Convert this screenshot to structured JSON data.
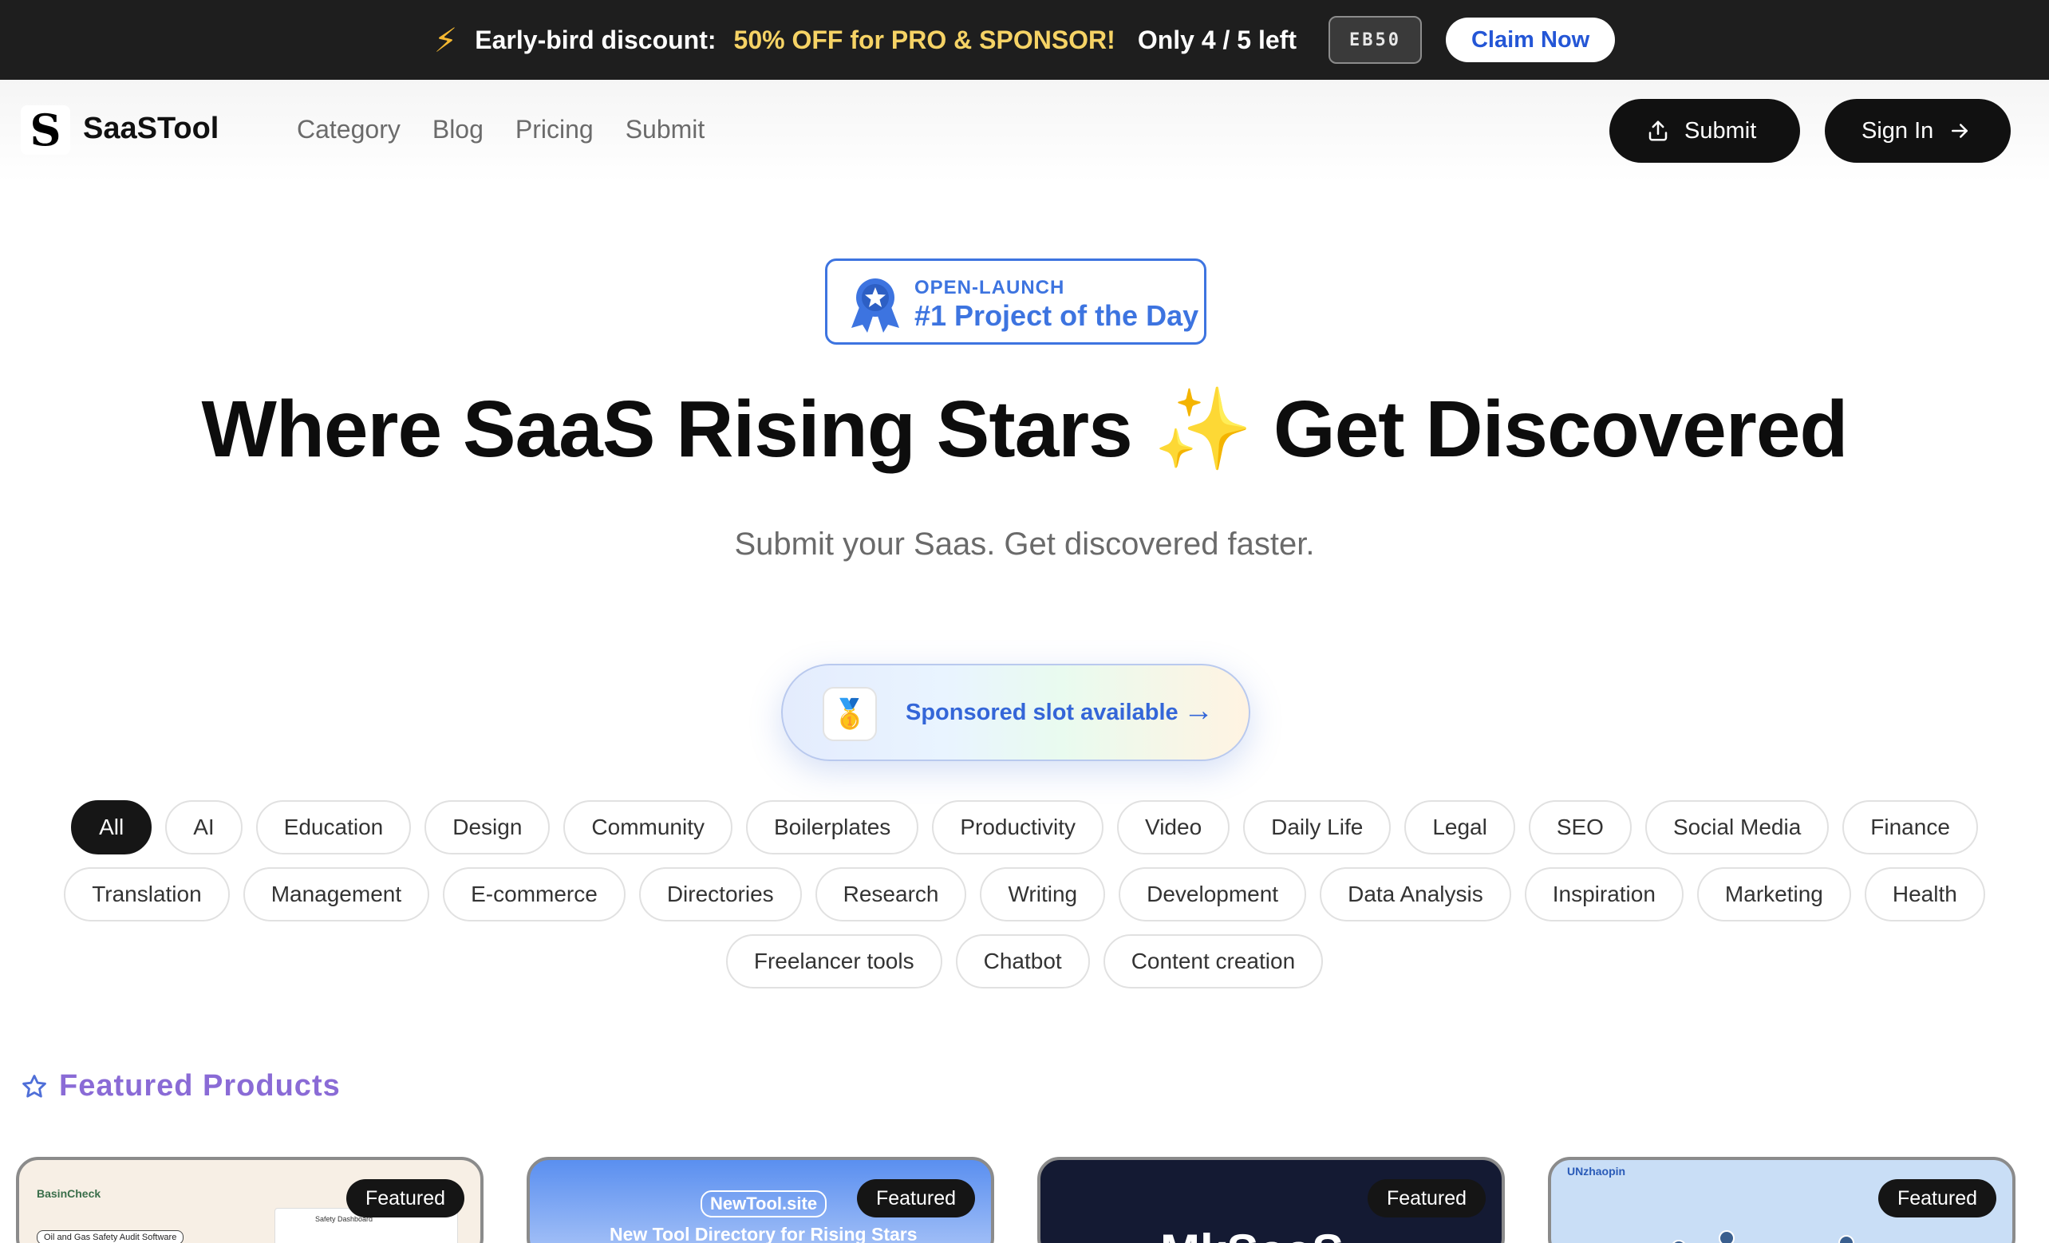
{
  "promo": {
    "lead": "Early-bird discount:",
    "highlight": "50% OFF for PRO & SPONSOR!",
    "remaining": "Only 4 / 5 left",
    "code": "EB50",
    "cta": "Claim Now"
  },
  "header": {
    "logo_letter": "S",
    "brand": "SaaSTool",
    "nav": [
      "Category",
      "Blog",
      "Pricing",
      "Submit"
    ],
    "submit_label": "Submit",
    "signin_label": "Sign In"
  },
  "badge": {
    "line1": "OPEN-LAUNCH",
    "line2": "#1 Project of the Day"
  },
  "hero": {
    "title_left": "Where SaaS Rising Stars",
    "title_emoji": "✨",
    "title_right": "Get Discovered",
    "subtitle": "Submit your Saas. Get discovered faster."
  },
  "sponsor": {
    "icon": "🥇",
    "label": "Sponsored slot available",
    "arrow": "→"
  },
  "categories": {
    "row1": [
      "All",
      "AI",
      "Education",
      "Design",
      "Community",
      "Boilerplates",
      "Productivity",
      "Video",
      "Daily Life",
      "Legal",
      "SEO",
      "Social Media",
      "Finance"
    ],
    "row2": [
      "Translation",
      "Management",
      "E-commerce",
      "Directories",
      "Research",
      "Writing",
      "Development",
      "Data Analysis",
      "Inspiration",
      "Marketing",
      "Health"
    ],
    "row3": [
      "Freelancer tools",
      "Chatbot",
      "Content creation"
    ],
    "active": "All"
  },
  "featured": {
    "heading": "Featured Products",
    "tag": "Featured",
    "cards": [
      {
        "brand": "BasinCheck",
        "subtitle": "Oil and Gas Safety Audit Software",
        "panel": "Safety Dashboard"
      },
      {
        "site": "NewTool.site",
        "tagline": "New Tool Directory for Rising Stars"
      },
      {
        "name": "MkSaaS"
      },
      {
        "name": "UNzhaopin"
      }
    ]
  },
  "colors": {
    "promo_bg": "#1e1e1e",
    "promo_highlight": "#f6d365",
    "accent_blue": "#3d74e0",
    "featured_purple": "#8a6bd6",
    "button_dark": "#111111"
  },
  "icons": {
    "bolt": "lightning-icon",
    "upload": "upload-icon",
    "arrow_right": "arrow-right-icon",
    "medal": "award-ribbon-icon",
    "star": "star-outline-icon"
  }
}
